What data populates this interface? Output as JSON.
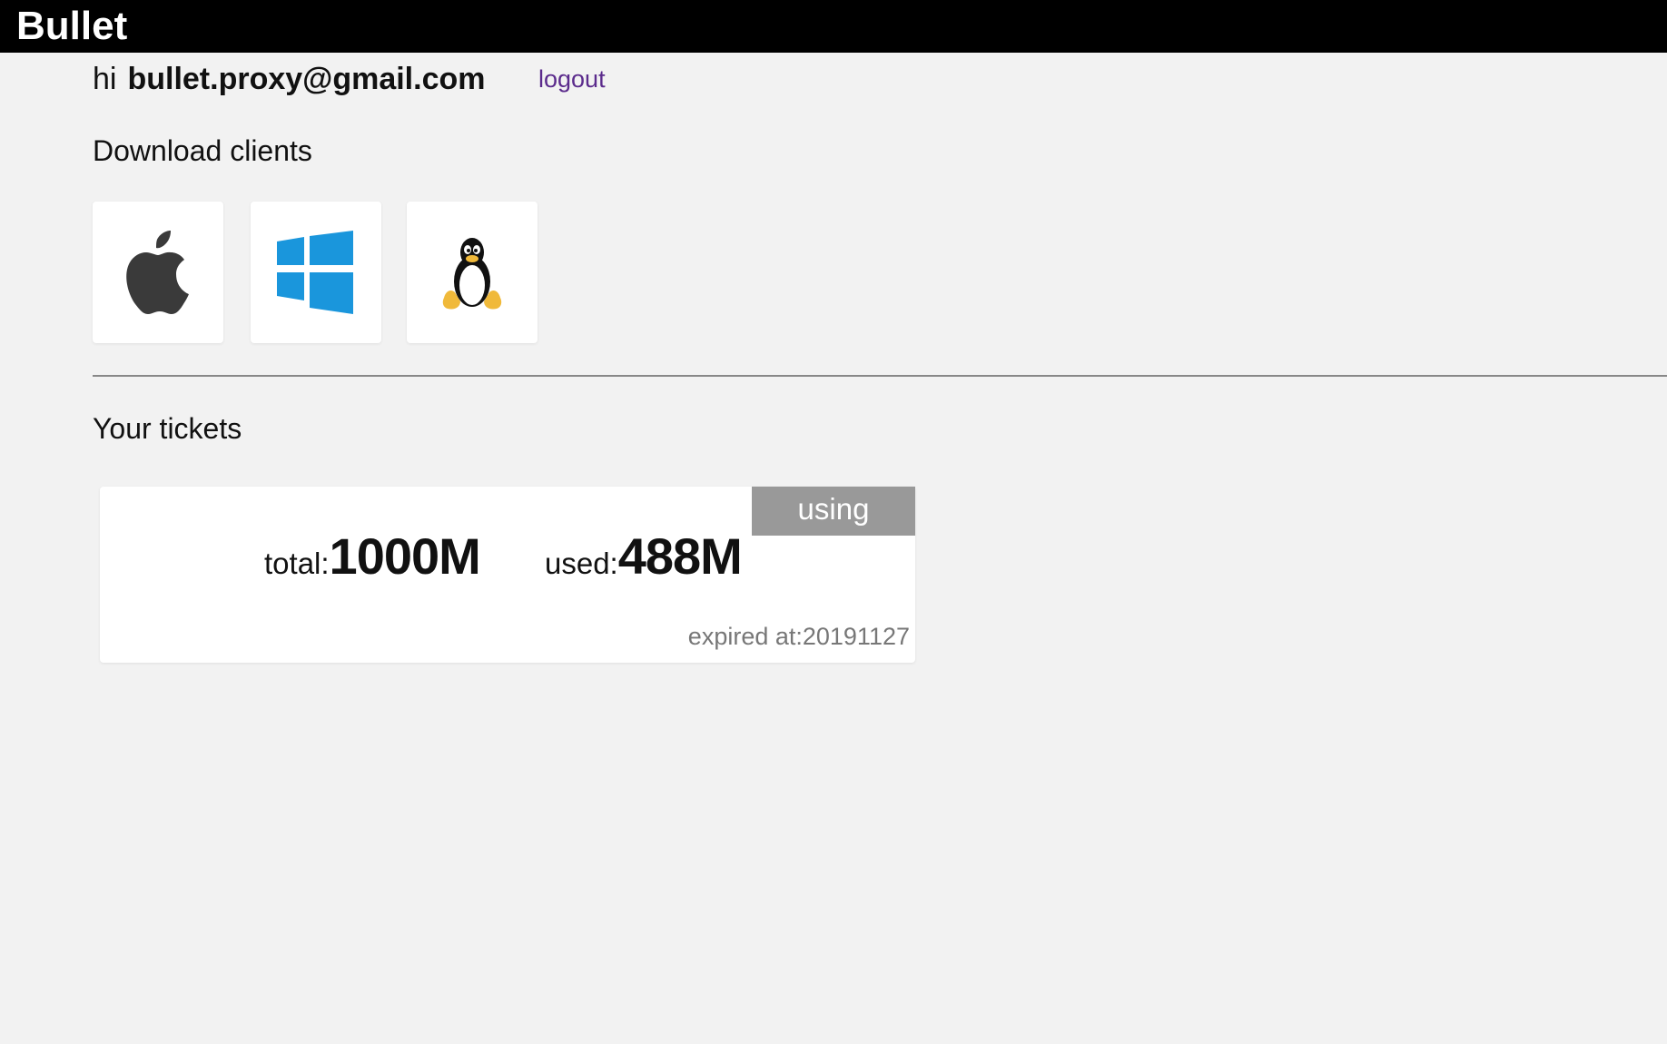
{
  "header": {
    "brand": "Bullet"
  },
  "user": {
    "greeting": "hi",
    "email": "bullet.proxy@gmail.com",
    "logout_label": "logout"
  },
  "clients": {
    "title": "Download clients",
    "items": [
      {
        "platform": "mac",
        "icon": "apple-icon"
      },
      {
        "platform": "windows",
        "icon": "windows-icon"
      },
      {
        "platform": "linux",
        "icon": "linux-penguin-icon"
      }
    ]
  },
  "tickets": {
    "title": "Your tickets",
    "items": [
      {
        "status": "using",
        "total_label": "total:",
        "total_value": "1000M",
        "used_label": "used:",
        "used_value": "488M",
        "expired": "expired at:20191127"
      }
    ]
  },
  "colors": {
    "topbar": "#000000",
    "background": "#f2f2f2",
    "logout_link": "#5b2b8c",
    "status_badge": "#999999",
    "windows_blue": "#1a96dc",
    "apple_gray": "#3a3a3a",
    "tux_yellow": "#f0b93a"
  }
}
